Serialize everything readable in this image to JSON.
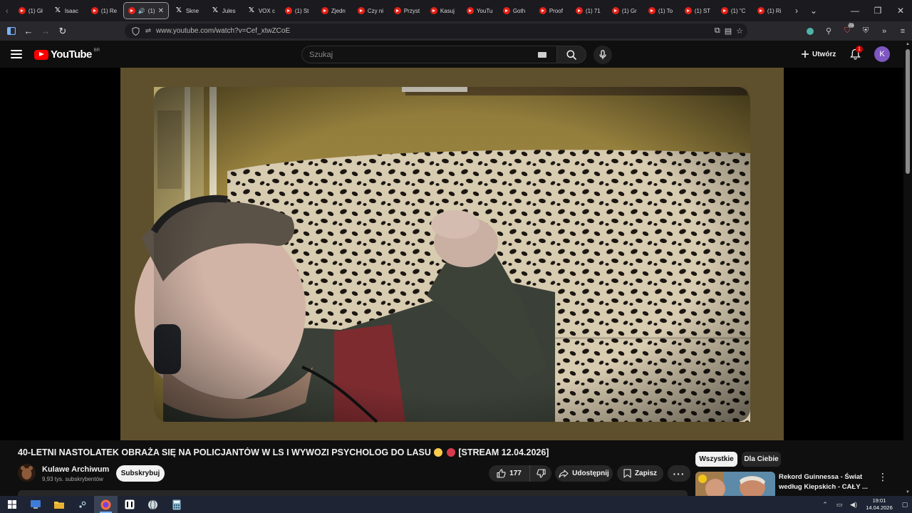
{
  "browser": {
    "tabs": [
      {
        "icon": "youtube",
        "label": "(1) Gł"
      },
      {
        "icon": "x",
        "label": "Isaac"
      },
      {
        "icon": "youtube",
        "label": "(1) Re"
      },
      {
        "icon": "youtube",
        "label": "(1)",
        "active": true
      },
      {
        "icon": "x",
        "label": "Skne"
      },
      {
        "icon": "x",
        "label": "Jules"
      },
      {
        "icon": "x",
        "label": "VOX c"
      },
      {
        "icon": "youtube",
        "label": "(1) St"
      },
      {
        "icon": "youtube",
        "label": "Zjedn"
      },
      {
        "icon": "youtube",
        "label": "Czy ni"
      },
      {
        "icon": "youtube",
        "label": "Przyst"
      },
      {
        "icon": "youtube",
        "label": "Kasuj"
      },
      {
        "icon": "youtube",
        "label": "YouTu"
      },
      {
        "icon": "youtube",
        "label": "Goth"
      },
      {
        "icon": "youtube",
        "label": "Proof"
      },
      {
        "icon": "youtube",
        "label": "(1) 71"
      },
      {
        "icon": "youtube",
        "label": "(1) Gr"
      },
      {
        "icon": "youtube",
        "label": "(1) To"
      },
      {
        "icon": "youtube",
        "label": "(1) ST"
      },
      {
        "icon": "youtube",
        "label": "(1) \"C"
      },
      {
        "icon": "youtube",
        "label": "(1) Ri"
      },
      {
        "icon": "youtube",
        "label": ""
      }
    ],
    "url": "www.youtube.com/watch?v=Cef_xtwZCoE",
    "extension_badge": "72"
  },
  "youtube": {
    "logo_text": "YouTube",
    "country_code": "BR",
    "search_placeholder": "Szukaj",
    "create_label": "Utwórz",
    "notification_count": "1",
    "avatar_letter": "K"
  },
  "video": {
    "title_part1": "40-LETNI NASTOLATEK OBRAŻA SIĘ NA POLICJANTÓW W LS I WYWOZI PSYCHOLOG DO LASU",
    "title_part2": "[STREAM 12.04.2026]",
    "channel_name": "Kulawe Archiwum",
    "subscribers": "9,93 tys. subskrybentów",
    "subscribe_label": "Subskrybuj",
    "likes": "177",
    "share_label": "Udostępnij",
    "save_label": "Zapisz"
  },
  "sidebar": {
    "chips": [
      "Wszystkie",
      "Dla Ciebie"
    ],
    "recommendation_title": "Rekord Guinnessa - Świat według Kiepskich - CAŁY ..."
  },
  "taskbar": {
    "time": "19:01",
    "date": "14.04.2026"
  },
  "colors": {
    "youtube_red": "#ff0000",
    "background": "#0f0f0f",
    "chip_active": "#f1f1f1",
    "avatar": "#7e57c2"
  }
}
